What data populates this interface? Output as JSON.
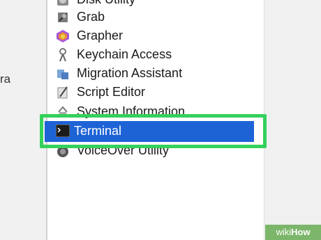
{
  "left_pane": {
    "fragment": "ra"
  },
  "apps": [
    {
      "label": "Disk Utility",
      "icon": "disk-utility-icon"
    },
    {
      "label": "Grab",
      "icon": "grab-icon"
    },
    {
      "label": "Grapher",
      "icon": "grapher-icon"
    },
    {
      "label": "Keychain Access",
      "icon": "keychain-icon"
    },
    {
      "label": "Migration Assistant",
      "icon": "migration-icon"
    },
    {
      "label": "Script Editor",
      "icon": "script-editor-icon"
    },
    {
      "label": "System Information",
      "icon": "system-info-icon"
    },
    {
      "label": "Terminal",
      "icon": "terminal-icon",
      "selected": true
    },
    {
      "label": "VoiceOver Utility",
      "icon": "voiceover-icon"
    }
  ],
  "colors": {
    "selection": "#1e63d6",
    "highlight": "#34d15b"
  },
  "watermark": {
    "prefix": "wiki",
    "suffix": "How"
  }
}
